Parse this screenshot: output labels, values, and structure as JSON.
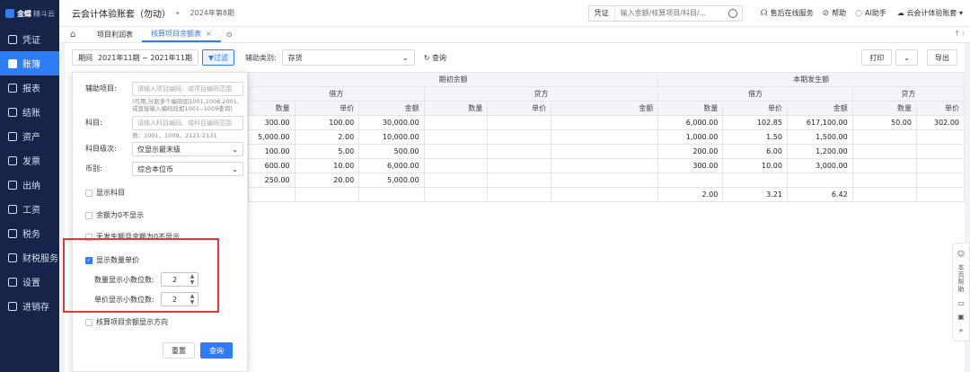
{
  "brand": {
    "name": "金蝶",
    "sub": "精斗云"
  },
  "sidebar": {
    "items": [
      {
        "label": "凭证",
        "icon": "voucher-icon"
      },
      {
        "label": "账簿",
        "icon": "book-icon"
      },
      {
        "label": "报表",
        "icon": "report-icon"
      },
      {
        "label": "结账",
        "icon": "close-icon"
      },
      {
        "label": "资产",
        "icon": "asset-icon"
      },
      {
        "label": "发票",
        "icon": "invoice-icon"
      },
      {
        "label": "出纳",
        "icon": "cashier-icon"
      },
      {
        "label": "工资",
        "icon": "salary-icon"
      },
      {
        "label": "税务",
        "icon": "tax-icon"
      },
      {
        "label": "财税服务",
        "icon": "service-icon"
      },
      {
        "label": "设置",
        "icon": "settings-icon"
      },
      {
        "label": "进销存",
        "icon": "inventory-icon"
      }
    ]
  },
  "topbar": {
    "book_name": "云会计体验账套（勿动）",
    "period": "2024年第8期",
    "search_type": "凭证",
    "search_placeholder": "输入金额/核算项目/科目/...",
    "service": "售后在线服务",
    "help": "帮助",
    "ai": "AI助手",
    "account": "云会计体验账套"
  },
  "tabs": {
    "items": [
      "项目利润表",
      "核算项目余额表"
    ],
    "active_close": "×",
    "more": "⊙"
  },
  "toolbar": {
    "period_label": "期间",
    "period_value": "2021年11期 ~ 2021年11期",
    "filter": "过滤",
    "aux_label": "辅助类别:",
    "aux_value": "存货",
    "refresh": "查询",
    "print": "打印",
    "export": "导出"
  },
  "panel": {
    "aux_item_label": "辅助项目:",
    "aux_item_placeholder": "请输入项目编码、或项目编码范围",
    "aux_item_hint": "(可用,分割多个编码如1001,1008,2001, 或直接输入编码段如1001--1009查询)",
    "account_label": "科目:",
    "account_placeholder": "请输入科目编码、或科目编码范围",
    "account_hint": "例：1001、1009、2121-2131",
    "level_label": "科目级次:",
    "level_value": "仅显示最末级",
    "currency_label": "币别:",
    "currency_value": "综合本位币",
    "chk_show_account": "显示科目",
    "chk_zero_balance": "余额为0不显示",
    "chk_no_occurrence": "无发生额且余额为0不显示",
    "chk_show_qty_price": "显示数量单价",
    "qty_decimals_label": "数量显示小数位数:",
    "qty_decimals_value": "2",
    "price_decimals_label": "单价显示小数位数:",
    "price_decimals_value": "2",
    "chk_show_direction": "核算项目余额显示方向",
    "reset": "重置",
    "query": "查询"
  },
  "table": {
    "group1": "期初余额",
    "group2": "本期发生额",
    "debit": "借方",
    "credit": "贷方",
    "qty": "数量",
    "price": "单价",
    "amount": "金额",
    "rows": [
      [
        "300.00",
        "100.00",
        "30,000.00",
        "",
        "",
        "",
        "6,000.00",
        "102.85",
        "617,100.00",
        "50.00",
        "302.00"
      ],
      [
        "5,000.00",
        "2.00",
        "10,000.00",
        "",
        "",
        "",
        "1,000.00",
        "1.50",
        "1,500.00",
        "",
        ""
      ],
      [
        "100.00",
        "5.00",
        "500.00",
        "",
        "",
        "",
        "200.00",
        "6.00",
        "1,200.00",
        "",
        ""
      ],
      [
        "600.00",
        "10.00",
        "6,000.00",
        "",
        "",
        "",
        "300.00",
        "10.00",
        "3,000.00",
        "",
        ""
      ],
      [
        "250.00",
        "20.00",
        "5,000.00",
        "",
        "",
        "",
        "",
        "",
        "",
        "",
        ""
      ],
      [
        "",
        "",
        "",
        "",
        "",
        "",
        "2.00",
        "3.21",
        "6.42",
        "",
        ""
      ]
    ]
  },
  "floatbar": {
    "label": "本页帮助"
  }
}
